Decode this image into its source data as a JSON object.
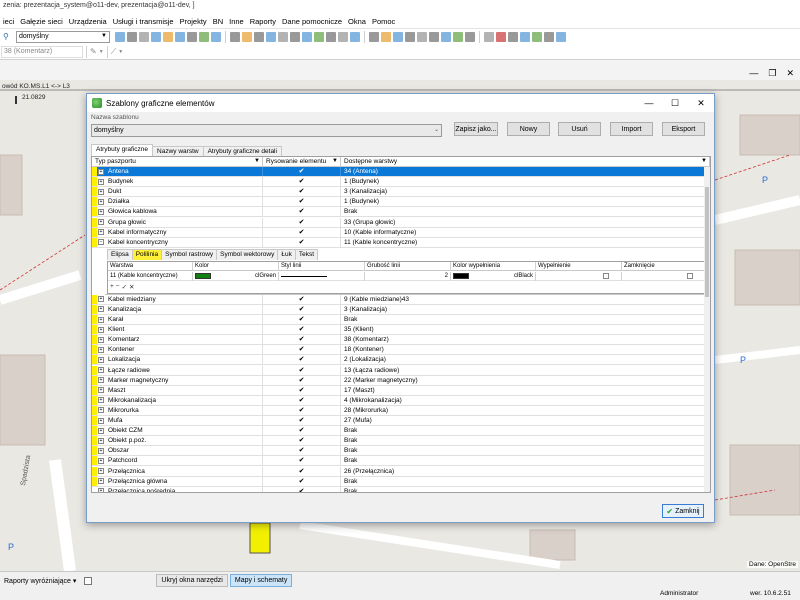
{
  "app": {
    "title": "zenia: prezentacja_system@o11-dev, prezentacja@o11-dev, ]",
    "menu": [
      "ieci",
      "Gałęzie sieci",
      "Urządzenia",
      "Usługi i transmisje",
      "Projekty",
      "BN",
      "Inne",
      "Raporty",
      "Dane pomocnicze",
      "Okna",
      "Pomoc"
    ],
    "toolbar_combo": "domyślny",
    "toolbar_combo2": "38 (Komentarz)"
  },
  "map": {
    "link_label": "owód KO.MS.L1 <-> L3",
    "coord": "21.0829",
    "street_label": "Spadzista",
    "attribution": "Dane: OpenStre",
    "parking_label": "P"
  },
  "statusbar": {
    "reports": "Raporty wyróżniające",
    "hide_tools": "Ukryj okna narzędzi",
    "maps_tab": "Mapy i schematy",
    "user": "Administrator",
    "version": "wer. 10.6.2.51"
  },
  "dialog": {
    "title": "Szablony graficzne elementów",
    "template_label": "Nazwa szablonu",
    "template_value": "domyślny",
    "buttons": {
      "save_as": "Zapisz jako...",
      "new": "Nowy",
      "delete": "Usuń",
      "import": "Import",
      "export": "Eksport",
      "close": "Zamknij"
    },
    "tabs": [
      "Atrybuty graficzne",
      "Nazwy warstw",
      "Atrybuty graficzne detali"
    ],
    "columns": [
      "Typ paszportu",
      "Rysowanie elementu",
      "Dostępne warstwy"
    ],
    "rows_before": [
      {
        "name": "Antena",
        "layer": "34 (Antena)",
        "selected": true
      },
      {
        "name": "Budynek",
        "layer": "1 (Budynek)"
      },
      {
        "name": "Dukt",
        "layer": "3 (Kanalizacja)"
      },
      {
        "name": "Działka",
        "layer": "1 (Budynek)"
      },
      {
        "name": "Głowica kablowa",
        "layer": "Brak"
      },
      {
        "name": "Grupa głowic",
        "layer": "33 (Grupa głowic)"
      },
      {
        "name": "Kabel informatyczny",
        "layer": "10 (Kable informatyczne)"
      },
      {
        "name": "Kabel koncentryczny",
        "layer": "11 (Kable koncentryczne)",
        "expanded": true
      }
    ],
    "sub": {
      "tabs": [
        "Elipsa",
        "Polilinia",
        "Symbol rastrowy",
        "Symbol wektorowy",
        "Łuk",
        "Tekst"
      ],
      "columns": [
        "Warstwa",
        "Kolor",
        "Styl linii",
        "Grubość linii",
        "Kolor wypełnienia",
        "Wypełnienie",
        "Zamknięcie"
      ],
      "row": {
        "layer": "11 (Kable koncentryczne)",
        "color_name": "clGreen",
        "color_hex": "#108010",
        "width": "2",
        "fill_name": "clBlack",
        "fill_hex": "#000000"
      },
      "nav": [
        "+",
        "−",
        "✓",
        "✕"
      ]
    },
    "rows_after": [
      {
        "name": "Kabel miedziany",
        "layer": "9 (Kable miedziane)43"
      },
      {
        "name": "Kanalizacja",
        "layer": "3 (Kanalizacja)"
      },
      {
        "name": "Karał",
        "layer": "Brak"
      },
      {
        "name": "Klient",
        "layer": "35 (Klient)"
      },
      {
        "name": "Komentarz",
        "layer": "38 (Komentarz)"
      },
      {
        "name": "Kontener",
        "layer": "18 (Kontener)"
      },
      {
        "name": "Lokalizacja",
        "layer": "2 (Lokalizacja)"
      },
      {
        "name": "Łącze radiowe",
        "layer": "13 (Łącza radiowe)"
      },
      {
        "name": "Marker magnetyczny",
        "layer": "22 (Marker magnetyczny)"
      },
      {
        "name": "Maszt",
        "layer": "17 (Maszt)"
      },
      {
        "name": "Mikrokanalizacja",
        "layer": "4 (Mikrokanalizacja)"
      },
      {
        "name": "Mikrorurka",
        "layer": "28 (Mikrorurka)"
      },
      {
        "name": "Mufa",
        "layer": "27 (Mufa)"
      },
      {
        "name": "Obiekt CZM",
        "layer": "Brak"
      },
      {
        "name": "Obiekt p.poż.",
        "layer": "Brak"
      },
      {
        "name": "Obszar",
        "layer": "Brak"
      },
      {
        "name": "Patchcord",
        "layer": "Brak"
      },
      {
        "name": "Przełącznica",
        "layer": "26 (Przełącznica)"
      },
      {
        "name": "Przełącznica główna",
        "layer": "Brak"
      },
      {
        "name": "Przełącznica pośrednia",
        "layer": "Brak"
      }
    ]
  }
}
